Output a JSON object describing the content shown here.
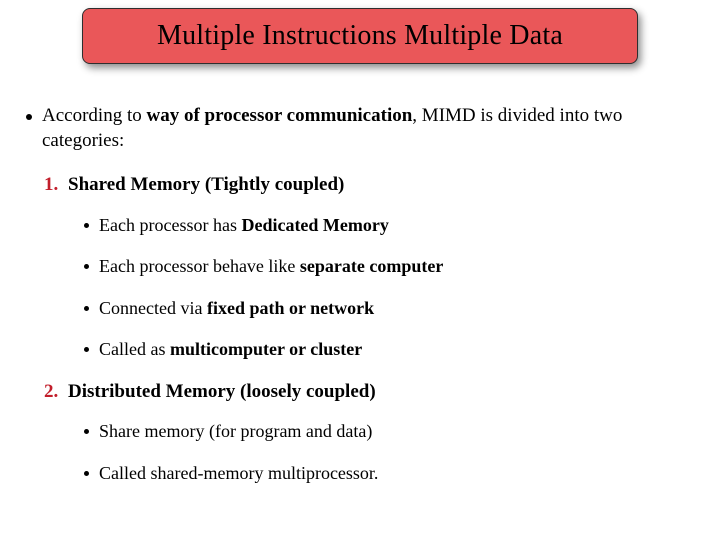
{
  "title": "Multiple Instructions Multiple Data",
  "intro": {
    "prefix": "According to ",
    "bold1": "way of processor communication",
    "after1": ", MIMD is divided into two categories:"
  },
  "items": [
    {
      "marker": "1.",
      "label": "Shared Memory (Tightly coupled)",
      "subs": [
        {
          "pre": "Each processor has ",
          "bold": "Dedicated Memory",
          "post": ""
        },
        {
          "pre": "Each processor behave like ",
          "bold": "separate computer",
          "post": ""
        },
        {
          "pre": "Connected via ",
          "bold": "fixed path or network",
          "post": ""
        },
        {
          "pre": "Called as ",
          "bold": "multicomputer or cluster",
          "post": ""
        }
      ]
    },
    {
      "marker": "2.",
      "label": "Distributed Memory  (loosely coupled)",
      "subs": [
        {
          "pre": "Share memory (for program and data)",
          "bold": "",
          "post": ""
        },
        {
          "pre": "Called shared-memory multiprocessor.",
          "bold": "",
          "post": ""
        }
      ]
    }
  ]
}
